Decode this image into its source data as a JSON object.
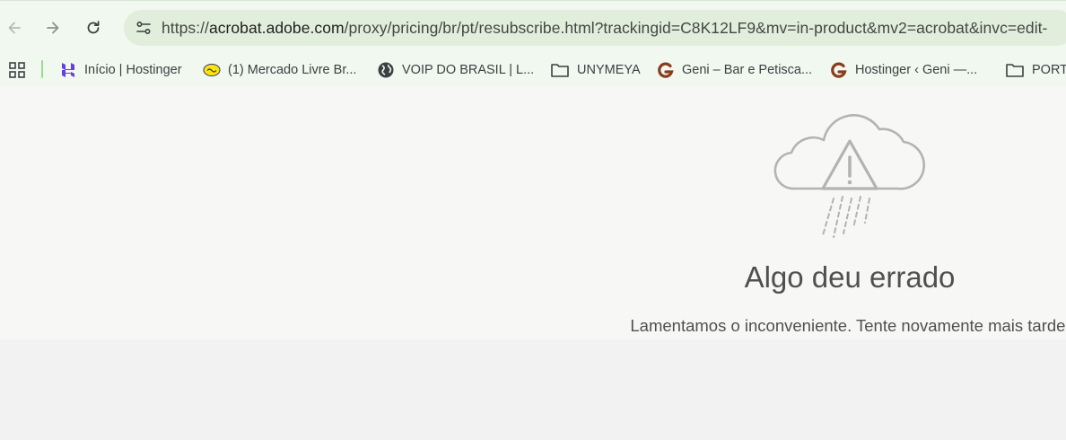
{
  "browser": {
    "address_bar": {
      "url_prefix": "https://",
      "url_host": "acrobat.adobe.com",
      "url_path": "/proxy/pricing/br/pt/resubscribe.html?trackingid=C8K12LF9&mv=in-product&mv2=acrobat&invc=edit-"
    },
    "bookmarks": [
      {
        "label": "Início | Hostinger",
        "icon": "hostinger-icon"
      },
      {
        "label": "(1) Mercado Livre Br...",
        "icon": "mercado-livre-icon"
      },
      {
        "label": "VOIP DO BRASIL | L...",
        "icon": "globe-icon"
      },
      {
        "label": "UNYMEYA",
        "icon": "folder-icon"
      },
      {
        "label": "Geni – Bar e Petisca...",
        "icon": "geni-icon"
      },
      {
        "label": "Hostinger ‹ Geni —...",
        "icon": "geni-icon"
      },
      {
        "label": "PORTA",
        "icon": "folder-icon"
      }
    ]
  },
  "error": {
    "title": "Algo deu errado",
    "message": "Lamentamos o inconveniente. Tente novamente mais tarde.",
    "icon": "cloud-warning-rain-icon"
  },
  "colors": {
    "toolbar_bg": "#f1f8ef",
    "omnibox_bg": "#e1eedb",
    "page_bg": "#f7f7f6",
    "error_text": "#505050"
  }
}
